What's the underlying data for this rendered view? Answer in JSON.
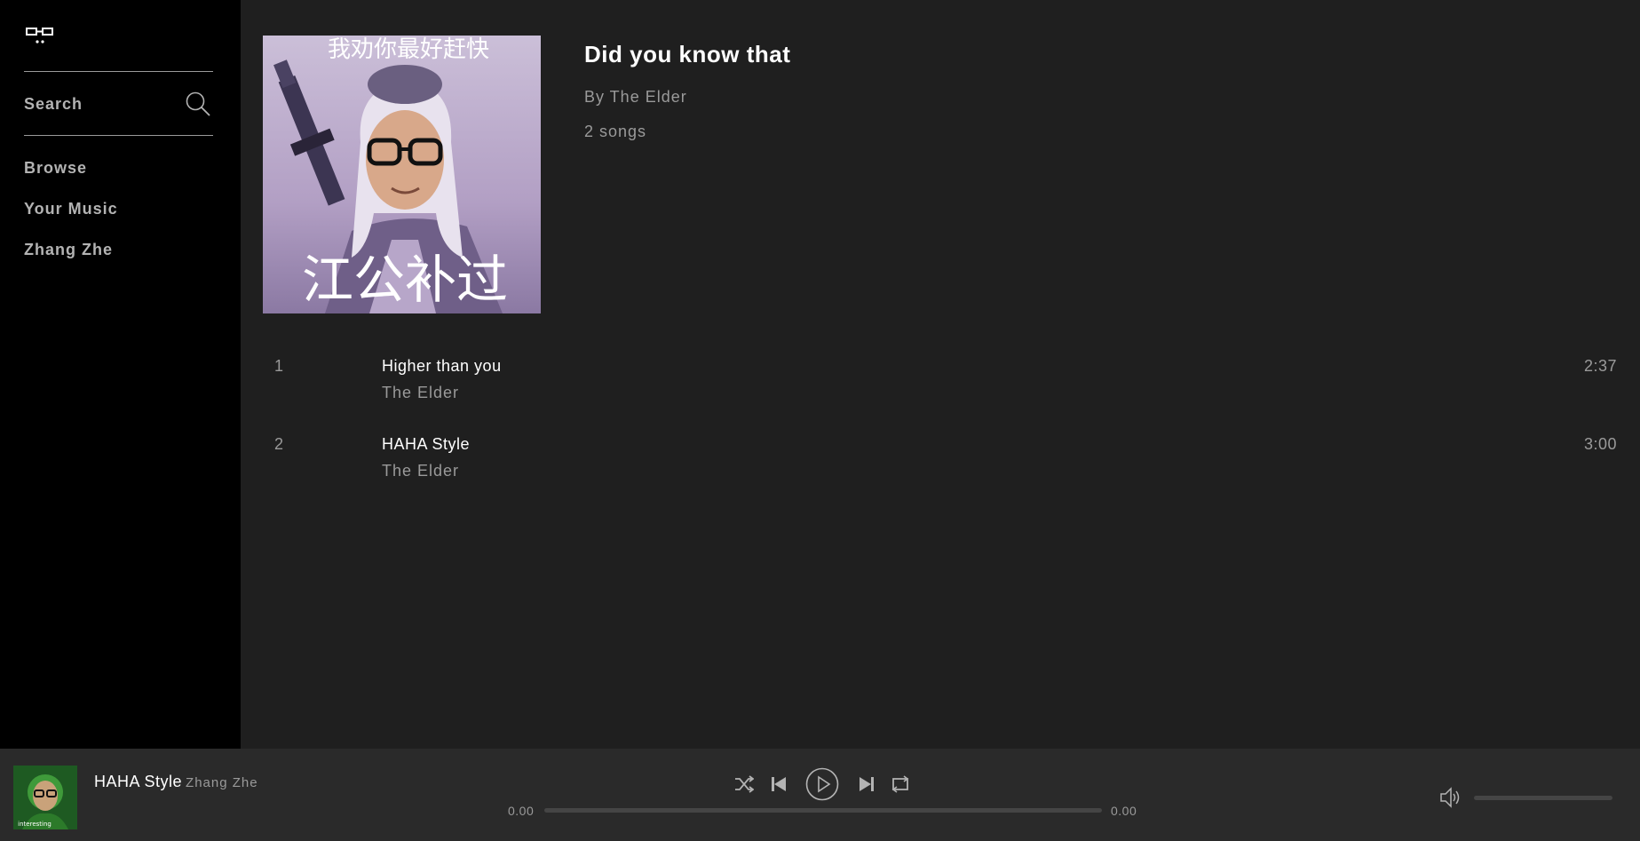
{
  "sidebar": {
    "logo_icon": "glasses-icon",
    "search": {
      "label": "Search",
      "icon": "search-icon"
    },
    "nav": [
      {
        "label": "Browse"
      },
      {
        "label": "Your Music"
      },
      {
        "label": "Zhang Zhe"
      }
    ]
  },
  "album": {
    "cover": {
      "caption_top": "我劝你最好赶快",
      "caption_bottom": "江公补过"
    },
    "title": "Did you know that",
    "by": "By The Elder",
    "count": "2 songs",
    "tracks": [
      {
        "num": "1",
        "name": "Higher than you",
        "artist": "The Elder",
        "duration": "2:37"
      },
      {
        "num": "2",
        "name": "HAHA Style",
        "artist": "The Elder",
        "duration": "3:00"
      }
    ]
  },
  "player": {
    "now_playing": {
      "title": "HAHA Style",
      "artist": "Zhang Zhe",
      "art_caption": "interesting"
    },
    "controls": [
      "shuffle-icon",
      "previous-icon",
      "play-icon",
      "next-icon",
      "repeat-icon"
    ],
    "time_elapsed": "0.00",
    "time_total": "0.00",
    "progress": 0,
    "volume_icon": "volume-icon",
    "volume": 0
  },
  "colors": {
    "sidebar_bg": "#000000",
    "main_bg": "#1f1f1f",
    "player_bg": "#2a2a2a",
    "text_primary": "#ffffff",
    "text_secondary": "#9a9a9a"
  }
}
